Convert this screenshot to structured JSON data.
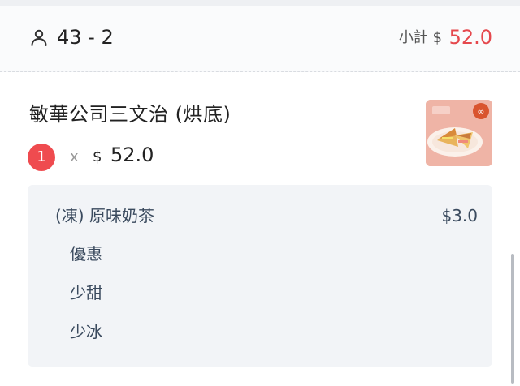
{
  "header": {
    "table_label": "43 - 2",
    "subtotal_label": "小計 $",
    "subtotal_value": "52.0",
    "person_icon": "person-icon"
  },
  "item": {
    "name": "敏華公司三文治 (烘底)",
    "quantity": "1",
    "times_symbol": "x",
    "currency_symbol": "$",
    "price": "52.0",
    "image_icon": "sandwich-thumbnail"
  },
  "options": {
    "drink_name": "(凍) 原味奶茶",
    "drink_price": "$3.0",
    "modifiers": [
      "優惠",
      "少甜",
      "少冰"
    ]
  },
  "colors": {
    "accent_red": "#e5484d",
    "badge_red": "#ef4b4f",
    "option_text": "#3a4a5e"
  }
}
